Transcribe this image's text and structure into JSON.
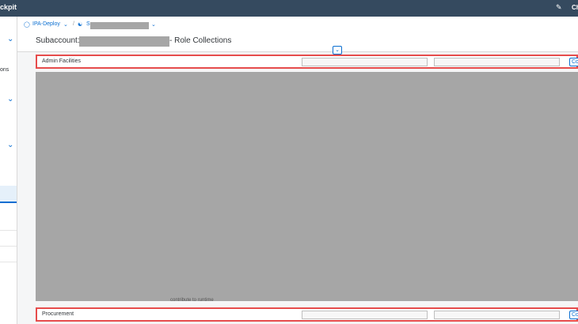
{
  "shell": {
    "brand": "ckpit",
    "right_label": "Ch",
    "notification_icon": "feedback-icon"
  },
  "sidebar": {
    "item_label": "ons"
  },
  "breadcrumb": {
    "global_account": "IPA-Deploy",
    "separator": "/",
    "subaccount_prefix": "S"
  },
  "page": {
    "title_prefix": "Subaccount:",
    "title_suffix": "- Role Collections"
  },
  "rows": [
    {
      "label": "Admin Facilities",
      "button": "Co"
    },
    {
      "label": "Procurement",
      "button": "Co"
    }
  ],
  "background_text": "contribute to runtime",
  "colors": {
    "shell": "#354a5f",
    "accent": "#0a6ed1",
    "highlight": "#e64c4c",
    "redaction": "#a6a6a6"
  }
}
